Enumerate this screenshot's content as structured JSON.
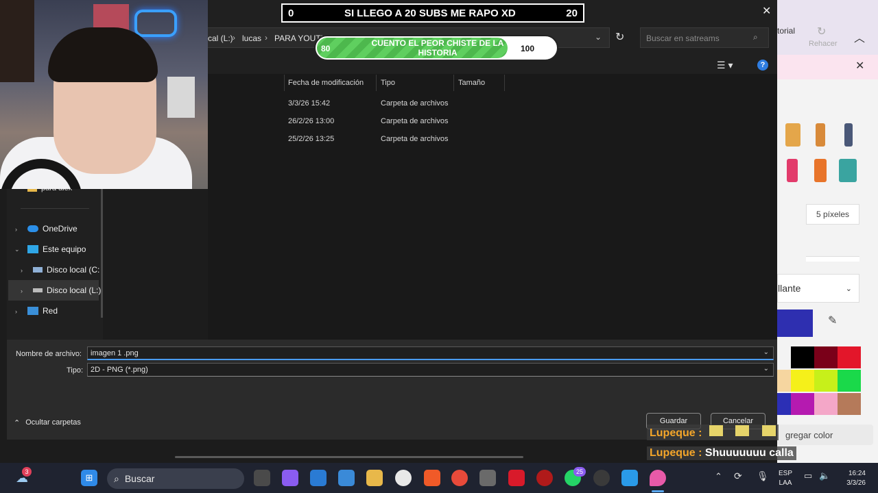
{
  "overlay": {
    "goal_left": "0",
    "goal_title": "SI LLEGO A 20 SUBS ME RAPO XD",
    "goal_right": "20",
    "goal2_left": "80",
    "goal2_text": "CUENTO EL PEOR CHISTE DE LA HISTORIA",
    "goal2_right": "100",
    "goal2_progress": 0.8
  },
  "dialog": {
    "breadcrumb": {
      "part1": "cal (L:)",
      "sep": "›",
      "part2": "lucas",
      "part3": "PARA YOUTUBE"
    },
    "search_placeholder": "Buscar en satreams",
    "columns": [
      "Fecha de modificación",
      "Tipo",
      "Tamaño"
    ],
    "rows": [
      {
        "date": "3/3/26 15:42",
        "type": "Carpeta de archivos",
        "size": ""
      },
      {
        "date": "26/2/26 13:00",
        "type": "Carpeta de archivos",
        "size": ""
      },
      {
        "date": "25/2/26 13:25",
        "type": "Carpeta de archivos",
        "size": ""
      }
    ],
    "sidebar": {
      "partial": "para alex",
      "items": [
        {
          "label": "OneDrive"
        },
        {
          "label": "Este equipo"
        },
        {
          "label": "Disco local (C:"
        },
        {
          "label": "Disco local (L:)"
        },
        {
          "label": "Red"
        }
      ]
    },
    "filename_label": "Nombre de archivo:",
    "filename_value": "imagen 1 .png",
    "type_label": "Tipo:",
    "type_value": "2D - PNG (*.png)",
    "hide_folders": "Ocultar carpetas",
    "save_button": "Guardar",
    "cancel_button": "Cancelar"
  },
  "paint": {
    "tutorial": "torial",
    "redo": "Rehacer",
    "pixels": "5 píxeles",
    "fill": "llante",
    "add_color": "gregar color",
    "colors": [
      "#000000",
      "#7a0019",
      "#e3162a",
      "#f6d6a0",
      "#f5f01a",
      "#c7f01a",
      "#1ad94a",
      "#2c2fb5",
      "#b51ab0",
      "#f4a7c8",
      "#b57a5a"
    ]
  },
  "chat": [
    {
      "user": "Lupeque",
      "sep": ":",
      "message": ""
    },
    {
      "user": "Lupeque",
      "sep": ":",
      "message": "Shuuuuuuu calla"
    }
  ],
  "taskbar": {
    "search": "Buscar",
    "weather_badge": "3",
    "whatsapp_badge": "25",
    "lang1": "ESP",
    "lang2": "LAA",
    "time": "16:24",
    "date": "3/3/26"
  }
}
